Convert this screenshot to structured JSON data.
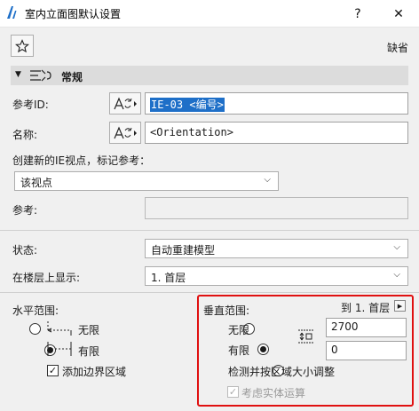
{
  "window": {
    "title": "室内立面图默认设置",
    "help": "?",
    "close": "✕"
  },
  "header": {
    "default_label": "缺省"
  },
  "section": {
    "title": "常规"
  },
  "ref_id": {
    "label": "参考ID:",
    "value": "IE-03 <编号>"
  },
  "name": {
    "label": "名称:",
    "value": "<Orientation>"
  },
  "create_new": {
    "label": "创建新的IE视点，标记参考：",
    "selected": "该视点"
  },
  "reference": {
    "label": "参考:",
    "value": ""
  },
  "status": {
    "label": "状态:",
    "selected": "自动重建模型"
  },
  "show_on_story": {
    "label": "在楼层上显示:",
    "selected": "1. 首层"
  },
  "horizontal_range": {
    "label": "水平范围:",
    "options": [
      {
        "label": "无限",
        "selected": false
      },
      {
        "label": "有限",
        "selected": true
      }
    ],
    "add_border": {
      "label": "添加边界区域",
      "checked": true
    }
  },
  "vertical_range": {
    "label": "垂直范围:",
    "to_story": "到 1. 首层",
    "options": [
      {
        "label": "无限",
        "selected": false
      },
      {
        "label": "有限",
        "selected": true
      },
      {
        "label": "检测并按区域大小调整",
        "selected": false
      }
    ],
    "top_value": "2700",
    "bottom_value": "0",
    "consider_solids": {
      "label": "考虑实体运算",
      "checked": true,
      "disabled": true
    }
  },
  "colors": {
    "highlight_border": "#e01010",
    "selection_bg": "#1e6fc8"
  }
}
